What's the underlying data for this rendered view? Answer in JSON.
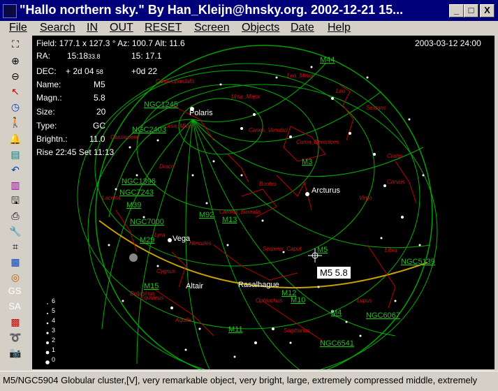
{
  "window": {
    "title": "\"Hallo northern sky.\"  By Han_Kleijn@hnsky.org.  2002-12-21  15...",
    "minimize": "_",
    "maximize": "□",
    "close": "X"
  },
  "menu": [
    "File",
    "Search",
    "IN",
    "OUT",
    "RESET",
    "Screen",
    "Objects",
    "Date",
    "Help"
  ],
  "info": {
    "field": "Field: 177.1  x 127.3 °  Az: 100.7  Alt: 11.6",
    "datetime": "2003-03-12  24:00",
    "ra_label": "RA:",
    "ra_value": "15:18",
    "ra_frac": "33.8",
    "ra_alt": "15: 17.1",
    "dec_label": "DEC:",
    "dec_value": "+ 2d 04",
    "dec_frac": "58",
    "dec_alt": "+0d 22",
    "name_label": "Name:",
    "name_value": "M5",
    "magn_label": "Magn.:",
    "magn_value": "5.8",
    "size_label": "Size:",
    "size_value": "20",
    "type_label": "Type:",
    "type_value": "GC",
    "bright_label": "Brightn.:",
    "bright_value": "11.0",
    "rise_set": "Rise 22:45  Set 11:13"
  },
  "tooltip": "M5  5.8",
  "magnitude_legend": [
    "6",
    "5",
    "4",
    "3",
    "2",
    "1",
    "0"
  ],
  "toolbar_labels": {
    "gs": "GS",
    "sa": "SA"
  },
  "objects": [
    "M44",
    "M3",
    "M92",
    "M13",
    "M39",
    "M29",
    "M5",
    "M15",
    "M10",
    "M12",
    "M11",
    "M4",
    "NGC5139",
    "NGC6067",
    "NGC6541",
    "NGC6633",
    "NGC7000",
    "NGC1396",
    "NGC1245",
    "M34",
    "NGC2403",
    "NGC7243"
  ],
  "stars": [
    "Polaris",
    "Arcturus",
    "Vega",
    "Deneb",
    "Altair",
    "Rasalhague"
  ],
  "constellations": [
    "Camelopardalis",
    "Ursa_Minor",
    "Ursa_Major",
    "Leo_Minor",
    "Leo",
    "Sextans",
    "Canes_Venatici",
    "Coma_Berenices",
    "Cassiopeia",
    "Draco",
    "Bootes",
    "Crater",
    "Corvus",
    "Virgo",
    "Lacerta",
    "Cepheus",
    "Corona_Borealis",
    "Hercules",
    "Serpens_Caput",
    "Lyra",
    "Cygnus",
    "Libra",
    "Lupus",
    "Ophiuchus",
    "Scutum",
    "Sagittarius",
    "Aquila",
    "Equuleus",
    "Delphinus",
    "Sagitta",
    "Vulpecula",
    "Pegasus",
    "Centaurus",
    "Hydra"
  ],
  "status": "M5/NGC5904  Globular cluster,[V], very remarkable object, very bright, large, extremely compressed middle, extremely"
}
